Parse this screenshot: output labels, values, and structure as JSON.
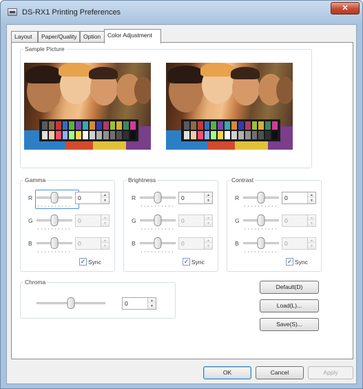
{
  "window": {
    "title": "DS-RX1 Printing Preferences",
    "close_glyph": "✕"
  },
  "tabs": [
    {
      "label": "Layout"
    },
    {
      "label": "Paper/Quality"
    },
    {
      "label": "Option"
    },
    {
      "label": "Color Adjustment",
      "active": true
    }
  ],
  "sample": {
    "legend": "Sample Picture"
  },
  "swatch_colors": [
    "#5a5a5a",
    "#8a6b4a",
    "#c23a3a",
    "#3a6bc2",
    "#5ab04a",
    "#7b4aa8",
    "#3aa8b0",
    "#d48a3a",
    "#3a3ab0",
    "#b03a6b",
    "#9ac23a",
    "#d4b03a",
    "#3a8a5a",
    "#d43a9a",
    "#e0e0e0",
    "#f4c8a8",
    "#ff4d6d",
    "#8fb0ff",
    "#a0ff8f",
    "#ffd24d",
    "#ffffff",
    "#d0d0d0",
    "#b0b0b0",
    "#909090",
    "#707070",
    "#505050",
    "#303030",
    "#101010"
  ],
  "gamma": {
    "legend": "Gamma",
    "channels": [
      {
        "label": "R",
        "value": "0",
        "position": 0.5,
        "enabled": true
      },
      {
        "label": "G",
        "value": "0",
        "position": 0.5,
        "enabled": false
      },
      {
        "label": "B",
        "value": "0",
        "position": 0.5,
        "enabled": false
      }
    ],
    "sync_label": "Sync",
    "sync_checked": true
  },
  "brightness": {
    "legend": "Brightness",
    "channels": [
      {
        "label": "R",
        "value": "0",
        "position": 0.5,
        "enabled": true
      },
      {
        "label": "G",
        "value": "0",
        "position": 0.5,
        "enabled": false
      },
      {
        "label": "B",
        "value": "0",
        "position": 0.5,
        "enabled": false
      }
    ],
    "sync_label": "Sync",
    "sync_checked": true
  },
  "contrast": {
    "legend": "Contrast",
    "channels": [
      {
        "label": "R",
        "value": "0",
        "position": 0.5,
        "enabled": true
      },
      {
        "label": "G",
        "value": "0",
        "position": 0.5,
        "enabled": false
      },
      {
        "label": "B",
        "value": "0",
        "position": 0.5,
        "enabled": false
      }
    ],
    "sync_label": "Sync",
    "sync_checked": true
  },
  "chroma": {
    "legend": "Chroma",
    "value": "0",
    "position": 0.5
  },
  "side_buttons": {
    "default": "Default(D)",
    "load": "Load(L)...",
    "save": "Save(S)..."
  },
  "footer": {
    "ok": "OK",
    "cancel": "Cancel",
    "apply": "Apply"
  },
  "spin_arrows": {
    "up": "▲",
    "down": "▼"
  },
  "checkmark": "✓"
}
